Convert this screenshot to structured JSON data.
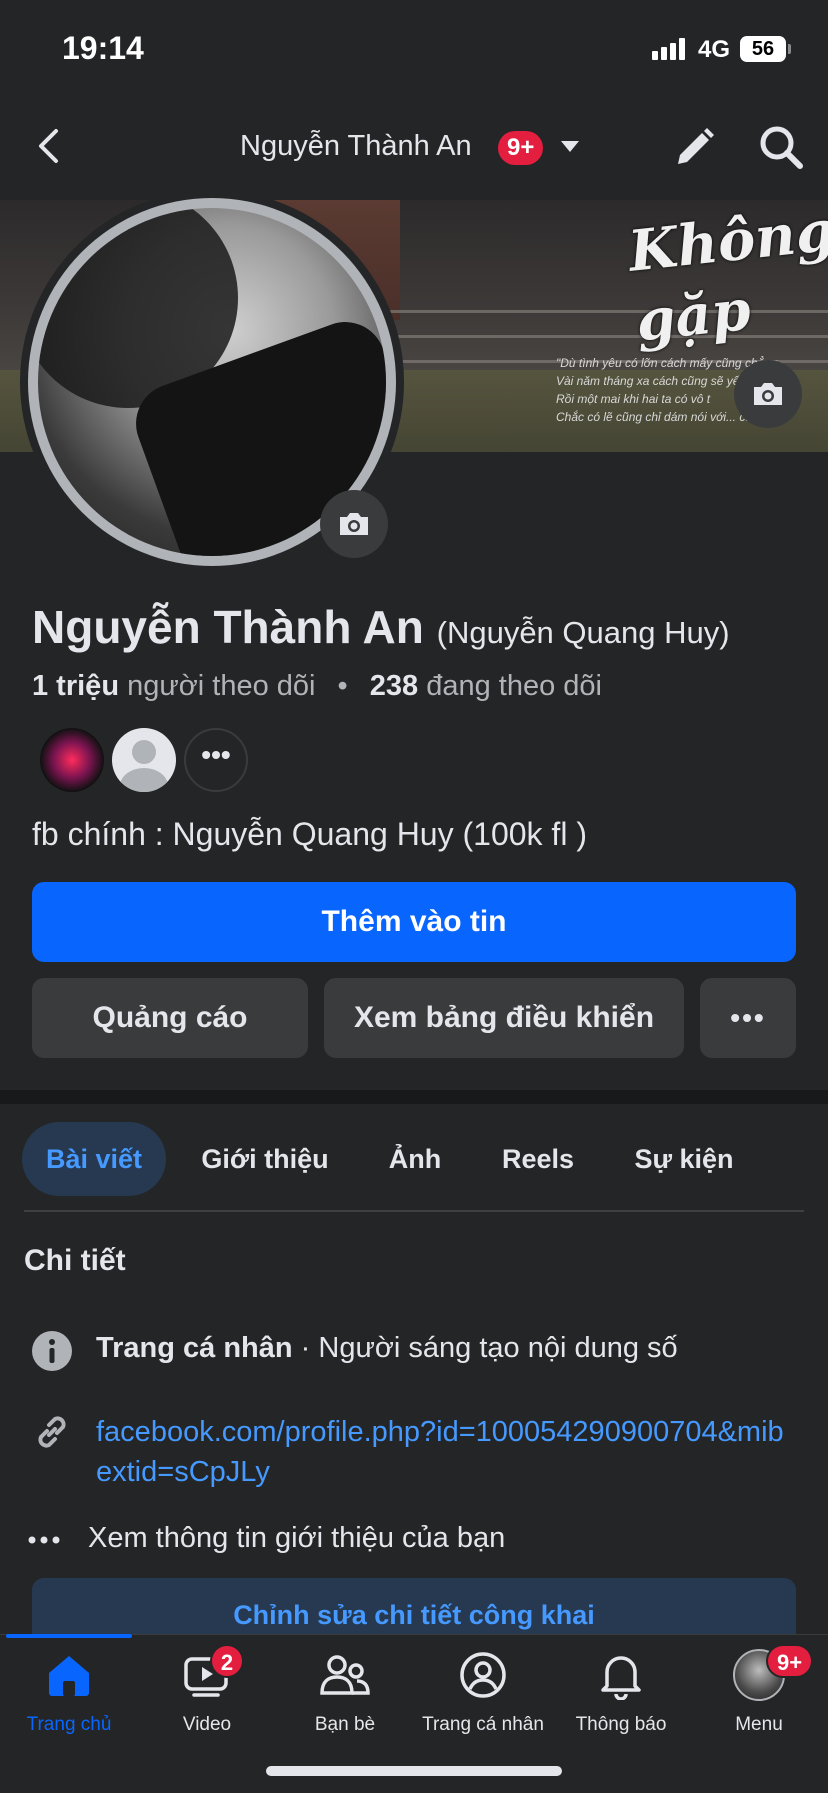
{
  "status_bar": {
    "time": "19:14",
    "network": "4G",
    "battery": "56"
  },
  "header": {
    "title": "Nguyễn Thành An",
    "badge": "9+"
  },
  "cover": {
    "title_text": "Không gặp",
    "quote_lines": [
      "\"Dù tình yêu có lỡn cách mấy cũng chẳng",
      "Vài năm tháng xa cách cũng sẽ yếu",
      "Rồi một mai khi hai ta có vô t",
      "Chắc có lẽ cũng chỉ dám nói với... câu: Xin"
    ]
  },
  "profile": {
    "name": "Nguyễn Thành An",
    "alternate_name": "(Nguyễn Quang Huy)",
    "followers_count": "1 triệu",
    "followers_label": "người theo dõi",
    "separator": "•",
    "following_count": "238",
    "following_label": "đang theo dõi",
    "more_glyph": "•••",
    "bio": "fb chính : Nguyễn Quang Huy (100k fl )"
  },
  "actions": {
    "primary": "Thêm vào tin",
    "ads": "Quảng cáo",
    "dashboard": "Xem bảng điều khiển",
    "more": "•••"
  },
  "tabs": [
    {
      "label": "Bài viết",
      "active": true
    },
    {
      "label": "Giới thiệu",
      "active": false
    },
    {
      "label": "Ảnh",
      "active": false
    },
    {
      "label": "Reels",
      "active": false
    },
    {
      "label": "Sự kiện",
      "active": false
    }
  ],
  "details": {
    "title": "Chi tiết",
    "profile_type_label": "Trang cá nhân",
    "profile_type_value": " · Người sáng tạo nội dung số",
    "link": "facebook.com/profile.php?id=100054290900704&mibextid=sCpJLy",
    "see_more": "Xem thông tin giới thiệu của bạn",
    "edit_button": "Chỉnh sửa chi tiết công khai"
  },
  "bottom_nav": [
    {
      "label": "Trang chủ",
      "icon": "home-icon",
      "active": true
    },
    {
      "label": "Video",
      "icon": "video-icon",
      "badge": "2"
    },
    {
      "label": "Bạn bè",
      "icon": "friends-icon"
    },
    {
      "label": "Trang cá nhân",
      "icon": "profile-icon"
    },
    {
      "label": "Thông báo",
      "icon": "bell-icon"
    },
    {
      "label": "Menu",
      "icon": "menu-avatar-icon",
      "badge": "9+"
    }
  ],
  "colors": {
    "background": "#242526",
    "accent": "#0866ff",
    "link": "#4599ff",
    "badge": "#e41e3f",
    "button_secondary": "#3a3b3c"
  }
}
